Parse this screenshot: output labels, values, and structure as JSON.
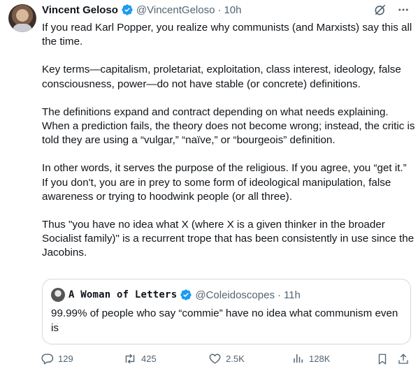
{
  "post": {
    "author_name": "Vincent Geloso",
    "handle": "@VincentGeloso",
    "separator": "·",
    "time": "10h",
    "paragraphs": [
      "If you read Karl Popper, you realize why communists (and Marxists) say this all the time.",
      "Key terms—capitalism, proletariat, exploitation, class interest, ideology, false consciousness, power—do not have stable (or concrete) definitions.",
      "The definitions expand and contract depending on what needs explaining. When a prediction fails, the theory does not become wrong; instead, the critic is told they are using a “vulgar,” “naïve,” or “bourgeois” definition.",
      "In other words, it serves the purpose of the religious. If  you agree, you “get it.” If you don't, you are in prey to some form of ideological manipulation, false awareness or trying to hoodwink people (or all three).",
      "Thus \"you have no idea what X (where X is a given thinker in the broader Socialist family)\" is a recurrent trope that has been consistently in use since the Jacobins."
    ]
  },
  "quote": {
    "author_name": "A Woman of Letters",
    "handle": "@Coleidoscopes",
    "separator": "·",
    "time": "11h",
    "text": "99.99% of people who say “commie” have no idea what communism even is"
  },
  "actions": {
    "replies": "129",
    "reposts": "425",
    "likes": "2.5K",
    "views": "128K"
  },
  "icons": [
    "verified-badge-icon",
    "grok-icon",
    "more-icon",
    "reply-icon",
    "repost-icon",
    "like-icon",
    "views-icon",
    "bookmark-icon",
    "share-icon"
  ],
  "colors": {
    "verified": "#1d9bf0",
    "muted": "#536471",
    "text": "#0f1419",
    "border": "#cfd9de"
  }
}
